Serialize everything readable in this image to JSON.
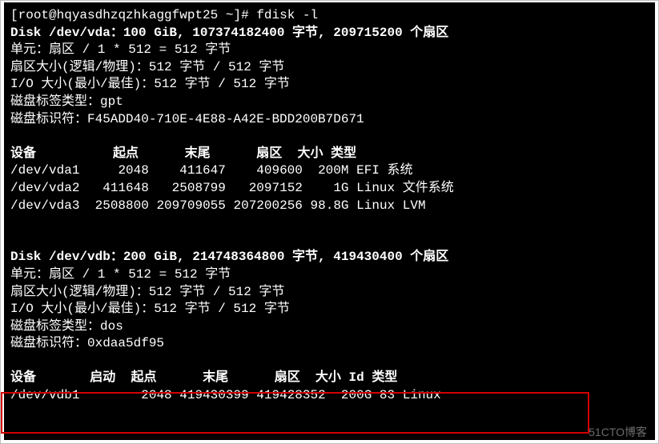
{
  "prompt": {
    "user": "root",
    "host": "hqyasdhzqzhkaggfwpt25",
    "dir": "~",
    "symbol": "#",
    "cmd": "fdisk -l"
  },
  "diskA": {
    "header": "Disk /dev/vda：100 GiB, 107374182400 字节, 209715200 个扇区",
    "units": "单元：扇区 / 1 * 512 = 512 字节",
    "sector": "扇区大小(逻辑/物理)：512 字节 / 512 字节",
    "io": "I/O 大小(最小/最佳)：512 字节 / 512 字节",
    "label": "磁盘标签类型：gpt",
    "ident": "磁盘标识符：F45ADD40-710E-4E88-A42E-BDD200B7D671",
    "cols": {
      "device": "设备",
      "start": "起点",
      "end": "末尾",
      "sectors": "扇区",
      "size": "大小",
      "type": "类型"
    },
    "rows": {
      "r1": {
        "device": "/dev/vda1",
        "start": "2048",
        "end": "411647",
        "sectors": "409600",
        "size": "200M",
        "type": "EFI 系统"
      },
      "r2": {
        "device": "/dev/vda2",
        "start": "411648",
        "end": "2508799",
        "sectors": "2097152",
        "size": "1G",
        "type": "Linux 文件系统"
      },
      "r3": {
        "device": "/dev/vda3",
        "start": "2508800",
        "end": "209709055",
        "sectors": "207200256",
        "size": "98.8G",
        "type": "Linux LVM"
      }
    }
  },
  "diskB": {
    "header": "Disk /dev/vdb：200 GiB, 214748364800 字节, 419430400 个扇区",
    "units": "单元：扇区 / 1 * 512 = 512 字节",
    "sector": "扇区大小(逻辑/物理)：512 字节 / 512 字节",
    "io": "I/O 大小(最小/最佳)：512 字节 / 512 字节",
    "label": "磁盘标签类型：dos",
    "ident": "磁盘标识符：0xdaa5df95",
    "cols": {
      "device": "设备",
      "boot": "启动",
      "start": "起点",
      "end": "末尾",
      "sectors": "扇区",
      "size": "大小",
      "id": "Id",
      "type": "类型"
    },
    "rows": {
      "r1": {
        "device": "/dev/vdb1",
        "boot": "",
        "start": "2048",
        "end": "419430399",
        "sectors": "419428352",
        "size": "200G",
        "id": "83",
        "type": "Linux"
      }
    }
  },
  "watermark": "51CTO博客"
}
